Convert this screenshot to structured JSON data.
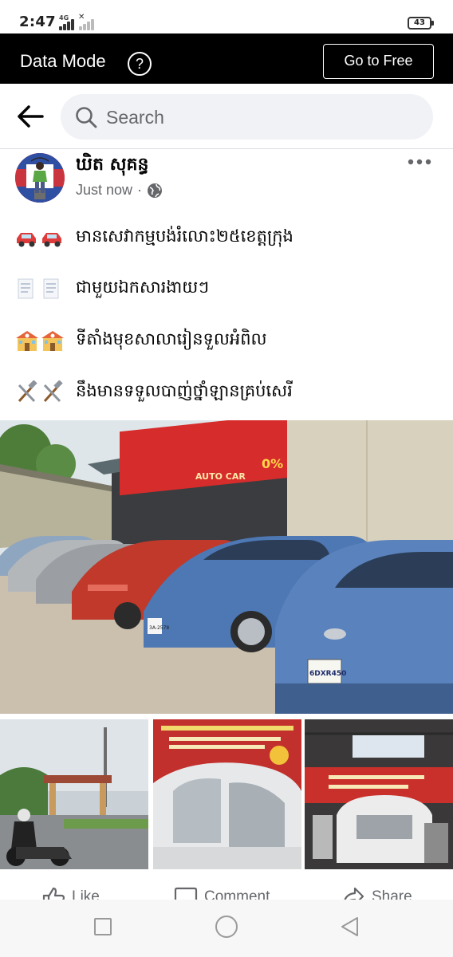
{
  "status_bar": {
    "time": "2:47",
    "network": "4G",
    "battery": "43"
  },
  "data_mode": {
    "label": "Data Mode",
    "help": "?",
    "go_free": "Go to Free"
  },
  "search": {
    "placeholder": "Search"
  },
  "post": {
    "author": "ឃិត សុគន្ធ",
    "time": "Just now",
    "separator": "·",
    "lines": [
      {
        "emoji": "car-emoji",
        "text": "មានសេវាកម្មបង់រំលោះ២៥ខេត្តក្រុង"
      },
      {
        "emoji": "document-emoji",
        "text": "ជាមួយឯកសារងាយៗ"
      },
      {
        "emoji": "school-emoji",
        "text": "ទីតាំងមុខសាលារៀនទួលអំពិល"
      },
      {
        "emoji": "tools-emoji",
        "text": "នឹងមានទទួលបាញ់ថ្នាំឡានគ្រប់សេរី"
      }
    ],
    "main_photo": {
      "sign_text": "AUTO CAR",
      "promo": "0%",
      "plate_front": "6DXR450",
      "plate_second": "3A-2578"
    },
    "actions": {
      "like": "Like",
      "comment": "Comment",
      "share": "Share"
    }
  },
  "colors": {
    "banner_bg": "#000000",
    "search_bg": "#f0f2f5",
    "muted_text": "#65676b",
    "sign_red": "#d62c2c",
    "car_blue": "#4d78b4",
    "car_red": "#c0392b"
  }
}
